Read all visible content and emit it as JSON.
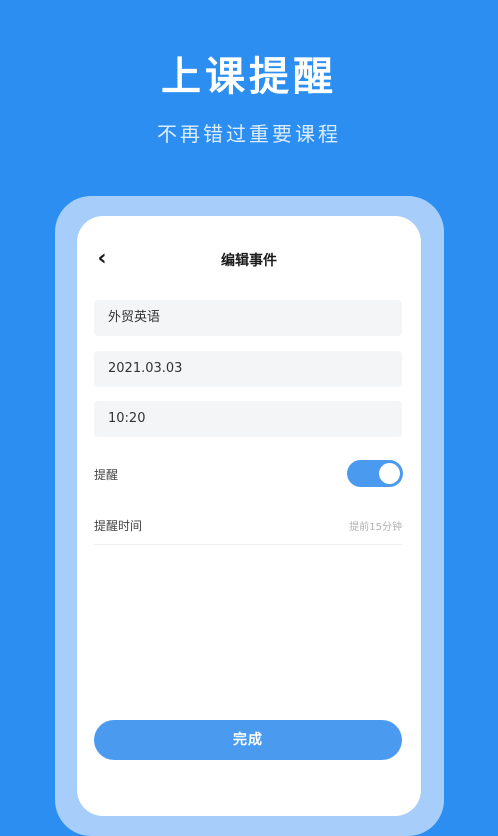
{
  "hero": {
    "title": "上课提醒",
    "subtitle": "不再错过重要课程"
  },
  "nav": {
    "back_icon": "‹",
    "title": "编辑事件"
  },
  "form": {
    "course_name": "外贸英语",
    "date": "2021.03.03",
    "time": "10:20",
    "reminder_label": "提醒",
    "reminder_enabled": true,
    "reminder_time_label": "提醒时间",
    "reminder_time_value": "提前15分钟"
  },
  "actions": {
    "done_label": "完成"
  },
  "colors": {
    "background": "#2b8ef0",
    "accent": "#4a9bf0",
    "frame": "#a7cefa"
  }
}
